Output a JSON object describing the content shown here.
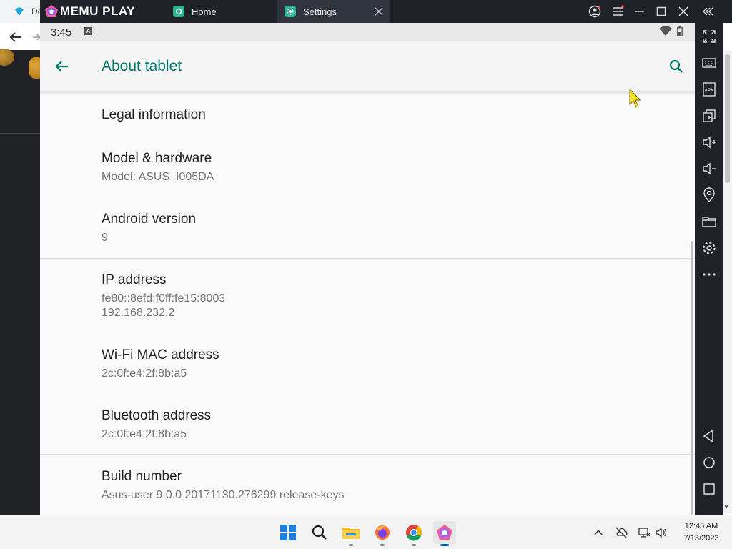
{
  "background_browser": {
    "tab_label": "Do"
  },
  "emulator": {
    "brand": "MEMU PLAY",
    "tabs": [
      {
        "label": "Home"
      },
      {
        "label": "Settings"
      }
    ]
  },
  "android": {
    "status": {
      "time": "3:45",
      "notification_glyph": "A"
    },
    "app_bar": {
      "title": "About tablet"
    },
    "items": [
      {
        "title": "Legal information"
      },
      {
        "title": "Model & hardware",
        "summary": "Model: ASUS_I005DA"
      },
      {
        "title": "Android version",
        "summary": "9"
      },
      {
        "title": "IP address",
        "summary_lines": [
          "fe80::8efd:f0ff:fe15:8003",
          "192.168.232.2"
        ]
      },
      {
        "title": "Wi-Fi MAC address",
        "summary": "2c:0f:e4:2f:8b:a5"
      },
      {
        "title": "Bluetooth address",
        "summary": "2c:0f:e4:2f:8b:a5"
      },
      {
        "title": "Build number",
        "summary": "Asus-user 9.0.0 20171130.276299 release-keys"
      }
    ]
  },
  "taskbar": {
    "apps": [
      "start-icon",
      "search-icon",
      "file-explorer-icon",
      "firefox-icon",
      "chrome-icon",
      "memu-icon"
    ],
    "clock": {
      "time": "12:45 AM",
      "date": "7/13/2023"
    }
  },
  "colors": {
    "accent": "#00796b",
    "memu_bar": "#1f2229"
  }
}
